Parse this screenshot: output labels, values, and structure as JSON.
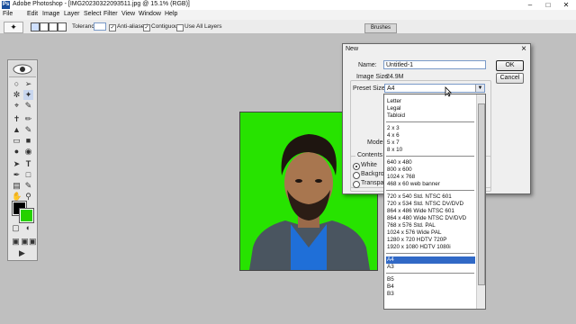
{
  "window": {
    "title": "Adobe Photoshop - [IMG20230322093511.jpg @ 15.1% (RGB)]"
  },
  "menu": [
    "File",
    "Edit",
    "Image",
    "Layer",
    "Select",
    "Filter",
    "View",
    "Window",
    "Help"
  ],
  "options_bar": {
    "tolerance_label": "Tolerance:",
    "tolerance_value": "32",
    "anti_aliased": "Anti-aliased",
    "contiguous": "Contiguous",
    "use_all_layers": "Use All Layers",
    "brushes_tab": "Brushes"
  },
  "dialog": {
    "title": "New",
    "name_label": "Name:",
    "name_value": "Untitled-1",
    "image_size_label": "Image Size:",
    "image_size_value": "24.9M",
    "preset_label": "Preset Sizes:",
    "preset_value": "A4",
    "ok": "OK",
    "cancel": "Cancel",
    "mode_label": "Mode:",
    "contents_label": "Contents",
    "contents_options": [
      "White",
      "Background",
      "Transparent"
    ],
    "contents_selected": "White"
  },
  "preset_list": {
    "groups": [
      [
        "Letter",
        "Legal",
        "Tabloid"
      ],
      [
        "2 x 3",
        "4 x 6",
        "5 x 7",
        "8 x 10"
      ],
      [
        "640 x 480",
        "800 x 600",
        "1024 x 768",
        "468 x 60 web banner"
      ],
      [
        "720 x 540 Std. NTSC 601",
        "720 x 534 Std. NTSC DV/DVD",
        "864 x 486 Wide NTSC 601",
        "864 x 480 Wide NTSC DV/DVD",
        "768 x 576 Std. PAL",
        "1024 x 576 Wide PAL",
        "1280 x 720 HDTV 720P",
        "1920 x 1080 HDTV 1080i"
      ],
      [
        "A4",
        "A3"
      ],
      [
        "B5",
        "B4",
        "B3"
      ]
    ],
    "selected": "A4"
  },
  "colors": {
    "foreground": "#000000",
    "background": "#26d100",
    "highlight": "#3169c6",
    "canvas": "#27e300"
  }
}
